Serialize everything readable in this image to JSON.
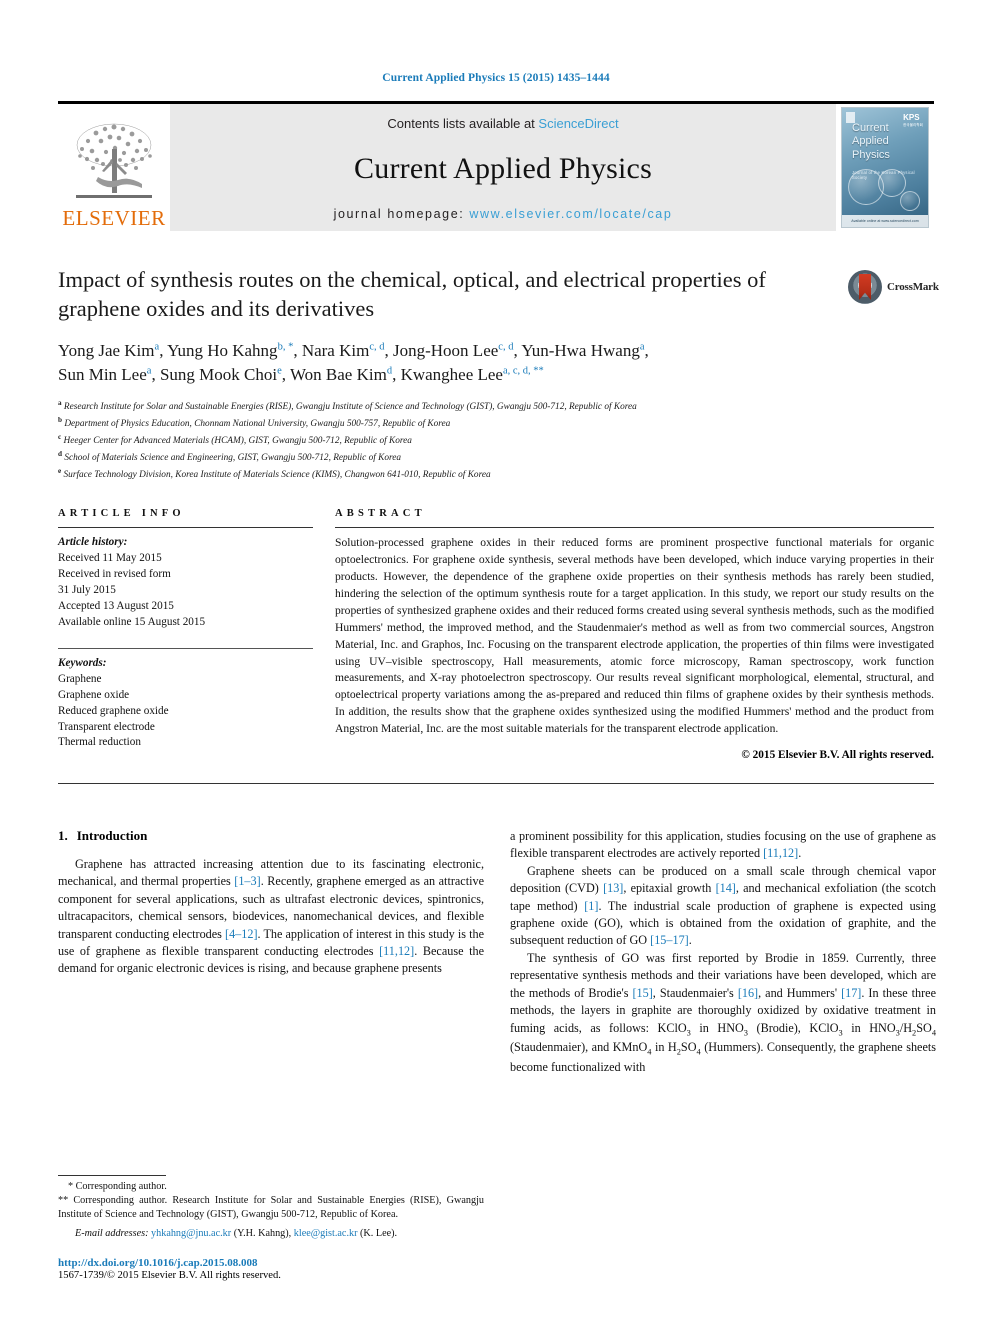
{
  "running_head": "Current Applied Physics 15 (2015) 1435–1444",
  "masthead": {
    "contents_prefix": "Contents lists available at ",
    "sciencedirect": "ScienceDirect",
    "journal_title": "Current Applied Physics",
    "homepage_prefix": "journal homepage: ",
    "homepage_url": "www.elsevier.com/locate/cap",
    "publisher": "ELSEVIER",
    "cover": {
      "title_line1": "Current",
      "title_line2": "Applied",
      "title_line3": "Physics",
      "subtitle": "Journal of the Korean Physical Society",
      "society": "KPS",
      "society_sub": "한국물리학회",
      "footer": "Available online at www.sciencedirect.com"
    },
    "accent_blue": "#3a9fd4",
    "elsevier_orange": "#E36C0A"
  },
  "article": {
    "title": "Impact of synthesis routes on the chemical, optical, and electrical properties of graphene oxides and its derivatives",
    "crossmark_label": "CrossMark",
    "authors_line1": "Yong Jae Kim ª, Yung Ho Kahng ᵇ·*, Nara Kim ᶜ·ᵈ, Jong-Hoon Lee ᶜ·ᵈ, Yun-Hwa Hwang ª,",
    "authors_line2": "Sun Min Lee ª, Sung Mook Choi ᵉ, Won Bae Kim ᵈ, Kwanghee Lee ª·ᶜ·ᵈ·**",
    "authors": [
      {
        "name": "Yong Jae Kim",
        "marks": "a"
      },
      {
        "name": "Yung Ho Kahng",
        "marks": "b, *"
      },
      {
        "name": "Nara Kim",
        "marks": "c, d"
      },
      {
        "name": "Jong-Hoon Lee",
        "marks": "c, d"
      },
      {
        "name": "Yun-Hwa Hwang",
        "marks": "a"
      },
      {
        "name": "Sun Min Lee",
        "marks": "a"
      },
      {
        "name": "Sung Mook Choi",
        "marks": "e"
      },
      {
        "name": "Won Bae Kim",
        "marks": "d"
      },
      {
        "name": "Kwanghee Lee",
        "marks": "a, c, d, **"
      }
    ],
    "affiliations": [
      {
        "mark": "a",
        "text": "Research Institute for Solar and Sustainable Energies (RISE), Gwangju Institute of Science and Technology (GIST), Gwangju 500-712, Republic of Korea"
      },
      {
        "mark": "b",
        "text": "Department of Physics Education, Chonnam National University, Gwangju 500-757, Republic of Korea"
      },
      {
        "mark": "c",
        "text": "Heeger Center for Advanced Materials (HCAM), GIST, Gwangju 500-712, Republic of Korea"
      },
      {
        "mark": "d",
        "text": "School of Materials Science and Engineering, GIST, Gwangju 500-712, Republic of Korea"
      },
      {
        "mark": "e",
        "text": "Surface Technology Division, Korea Institute of Materials Science (KIMS), Changwon 641-010, Republic of Korea"
      }
    ]
  },
  "article_info": {
    "heading": "ARTICLE INFO",
    "history_label": "Article history:",
    "history": [
      "Received 11 May 2015",
      "Received in revised form",
      "31 July 2015",
      "Accepted 13 August 2015",
      "Available online 15 August 2015"
    ],
    "keywords_label": "Keywords:",
    "keywords": [
      "Graphene",
      "Graphene oxide",
      "Reduced graphene oxide",
      "Transparent electrode",
      "Thermal reduction"
    ]
  },
  "abstract": {
    "heading": "ABSTRACT",
    "text": "Solution-processed graphene oxides in their reduced forms are prominent prospective functional materials for organic optoelectronics. For graphene oxide synthesis, several methods have been developed, which induce varying properties in their products. However, the dependence of the graphene oxide properties on their synthesis methods has rarely been studied, hindering the selection of the optimum synthesis route for a target application. In this study, we report our study results on the properties of synthesized graphene oxides and their reduced forms created using several synthesis methods, such as the modified Hummers' method, the improved method, and the Staudenmaier's method as well as from two commercial sources, Angstron Material, Inc. and Graphos, Inc. Focusing on the transparent electrode application, the properties of thin films were investigated using UV–visible spectroscopy, Hall measurements, atomic force microscopy, Raman spectroscopy, work function measurements, and X-ray photoelectron spectroscopy. Our results reveal significant morphological, elemental, structural, and optoelectrical property variations among the as-prepared and reduced thin films of graphene oxides by their synthesis methods. In addition, the results show that the graphene oxides synthesized using the modified Hummers' method and the product from Angstron Material, Inc. are the most suitable materials for the transparent electrode application.",
    "copyright": "© 2015 Elsevier B.V. All rights reserved."
  },
  "introduction": {
    "number": "1.",
    "title": "Introduction",
    "left_paragraphs": [
      "Graphene has attracted increasing attention due to its fascinating electronic, mechanical, and thermal properties [1–3]. Recently, graphene emerged as an attractive component for several applications, such as ultrafast electronic devices, spintronics, ultracapacitors, chemical sensors, biodevices, nanomechanical devices, and flexible transparent conducting electrodes [4–12]. The application of interest in this study is the use of graphene as flexible transparent conducting electrodes [11,12]. Because the demand for organic electronic devices is rising, and because graphene presents"
    ],
    "right_paragraphs": [
      "a prominent possibility for this application, studies focusing on the use of graphene as flexible transparent electrodes are actively reported [11,12].",
      "Graphene sheets can be produced on a small scale through chemical vapor deposition (CVD) [13], epitaxial growth [14], and mechanical exfoliation (the scotch tape method) [1]. The industrial scale production of graphene is expected using graphene oxide (GO), which is obtained from the oxidation of graphite, and the subsequent reduction of GO [15–17].",
      "The synthesis of GO was first reported by Brodie in 1859. Currently, three representative synthesis methods and their variations have been developed, which are the methods of Brodie's [15], Staudenmaier's [16], and Hummers' [17]. In these three methods, the layers in graphite are thoroughly oxidized by oxidative treatment in fuming acids, as follows: KClO3 in HNO3 (Brodie), KClO3 in HNO3/H2SO4 (Staudenmaier), and KMnO4 in H2SO4 (Hummers). Consequently, the graphene sheets become functionalized with"
    ]
  },
  "footnotes": {
    "star1": "* Corresponding author.",
    "star2": "** Corresponding author. Research Institute for Solar and Sustainable Energies (RISE), Gwangju Institute of Science and Technology (GIST), Gwangju 500-712, Republic of Korea.",
    "email_label": "E-mail addresses:",
    "email1": "yhkahng@jnu.ac.kr",
    "email1_owner": "(Y.H. Kahng),",
    "email2": "klee@gist.ac.kr",
    "email2_owner": "(K. Lee).",
    "doi": "http://dx.doi.org/10.1016/j.cap.2015.08.008",
    "issn_line": "1567-1739/© 2015 Elsevier B.V. All rights reserved."
  }
}
